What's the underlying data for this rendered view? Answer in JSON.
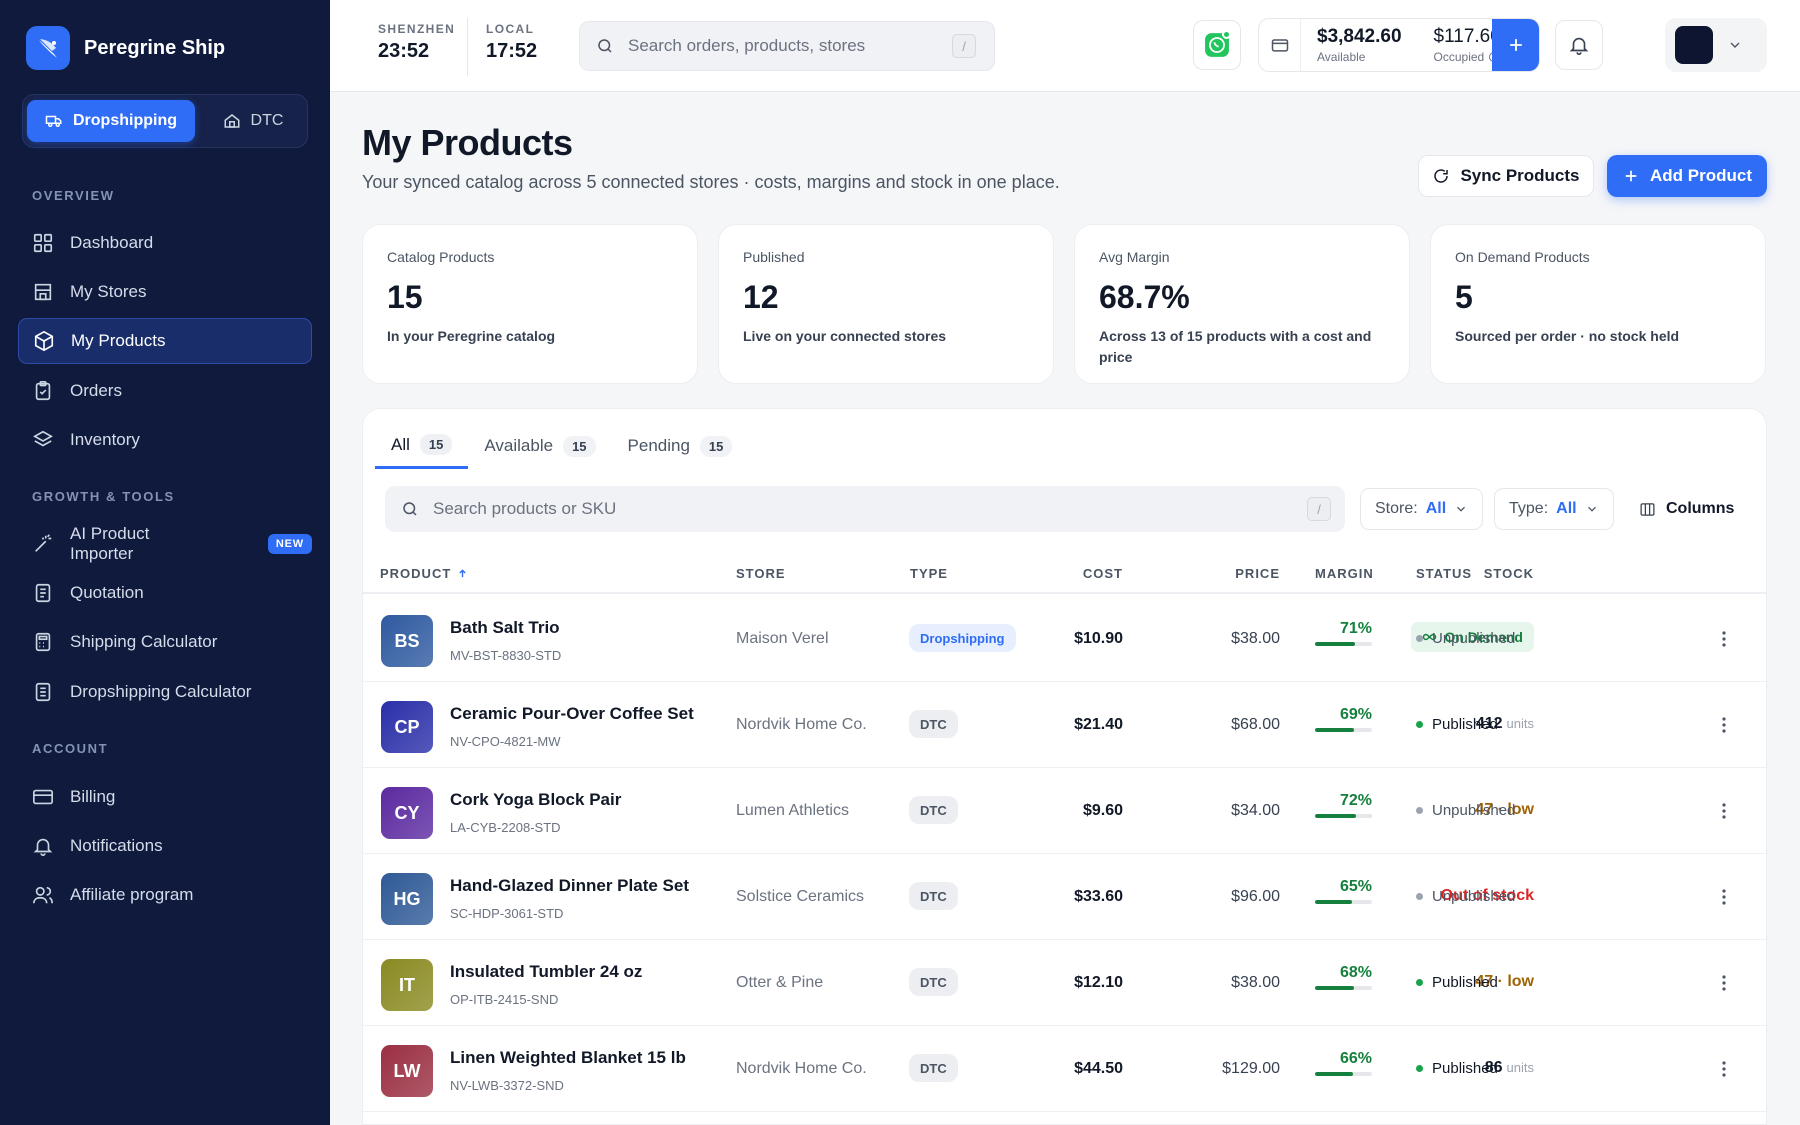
{
  "brand": {
    "name": "Peregrine Ship"
  },
  "mode_switch": {
    "active": "Dropshipping",
    "inactive": "DTC"
  },
  "sidebar": {
    "sections": {
      "overview": "OVERVIEW",
      "growth": "GROWTH & TOOLS",
      "account": "ACCOUNT"
    },
    "items": [
      {
        "label": "Dashboard",
        "icon": "grid-icon"
      },
      {
        "label": "My Stores",
        "icon": "store-icon"
      },
      {
        "label": "My Products",
        "icon": "box-icon",
        "active": true
      },
      {
        "label": "Orders",
        "icon": "clipboard-icon"
      },
      {
        "label": "Inventory",
        "icon": "layers-icon"
      },
      {
        "label": "AI Product Importer",
        "icon": "magic-wand-icon",
        "badge": "NEW"
      },
      {
        "label": "Quotation",
        "icon": "document-icon"
      },
      {
        "label": "Shipping Calculator",
        "icon": "calculator-icon"
      },
      {
        "label": "Dropshipping Calculator",
        "icon": "document-icon"
      },
      {
        "label": "Billing",
        "icon": "credit-card-icon"
      },
      {
        "label": "Notifications",
        "icon": "bell-icon"
      },
      {
        "label": "Affiliate program",
        "icon": "users-icon"
      }
    ]
  },
  "topbar": {
    "clocks": [
      {
        "label": "SHENZHEN",
        "time": "23:52"
      },
      {
        "label": "LOCAL",
        "time": "17:52"
      }
    ],
    "search_placeholder": "Search orders, products, stores",
    "search_shortcut": "/",
    "wallet": {
      "available_amount": "$3,842.60",
      "available_label": "Available",
      "occupied_amount": "$117.60",
      "occupied_label": "Occupied"
    }
  },
  "page": {
    "title": "My Products",
    "subtitle": "Your synced catalog across 5 connected stores · costs, margins and stock in one place.",
    "sync_label": "Sync Products",
    "add_label": "Add Product"
  },
  "stats": [
    {
      "label": "Catalog Products",
      "value": "15",
      "desc": "In your Peregrine catalog"
    },
    {
      "label": "Published",
      "value": "12",
      "desc": "Live on your connected stores"
    },
    {
      "label": "Avg Margin",
      "value": "68.7%",
      "desc": "Across 13 of 15 products with a cost and price"
    },
    {
      "label": "On Demand Products",
      "value": "5",
      "desc": "Sourced per order · no stock held"
    }
  ],
  "tabs": [
    {
      "label": "All",
      "count": "15"
    },
    {
      "label": "Available",
      "count": "15"
    },
    {
      "label": "Pending",
      "count": "15"
    }
  ],
  "filters": {
    "search_placeholder": "Search products or SKU",
    "search_shortcut": "/",
    "store_label": "Store:",
    "store_value": "All",
    "type_label": "Type:",
    "type_value": "All",
    "columns_label": "Columns"
  },
  "table": {
    "headers": {
      "product": "PRODUCT",
      "store": "STORE",
      "type": "TYPE",
      "cost": "COST",
      "price": "PRICE",
      "margin": "MARGIN",
      "stock": "STOCK",
      "status": "STATUS"
    },
    "rows": [
      {
        "initials": "BS",
        "color": "#2f5aa0",
        "name": "Bath Salt Trio",
        "sku": "MV-BST-8830-STD",
        "store": "Maison Verel",
        "type": "Dropshipping",
        "cost": "$10.90",
        "price": "$38.00",
        "margin": "71%",
        "margin_value": 71,
        "stock_kind": "ondemand",
        "stock": "On Demand",
        "stock_unit": "",
        "status": "Unpublished"
      },
      {
        "initials": "CP",
        "color": "#2a2fa8",
        "name": "Ceramic Pour-Over Coffee Set",
        "sku": "NV-CPO-4821-MW",
        "store": "Nordvik Home Co.",
        "type": "DTC",
        "cost": "$21.40",
        "price": "$68.00",
        "margin": "69%",
        "margin_value": 69,
        "stock_kind": "units",
        "stock": "412",
        "stock_unit": "units",
        "status": "Published"
      },
      {
        "initials": "CY",
        "color": "#5b2aa0",
        "name": "Cork Yoga Block Pair",
        "sku": "LA-CYB-2208-STD",
        "store": "Lumen Athletics",
        "type": "DTC",
        "cost": "$9.60",
        "price": "$34.00",
        "margin": "72%",
        "margin_value": 72,
        "stock_kind": "low",
        "stock": "47 · low",
        "stock_unit": "",
        "status": "Unpublished"
      },
      {
        "initials": "HG",
        "color": "#2f5a96",
        "name": "Hand-Glazed Dinner Plate Set",
        "sku": "SC-HDP-3061-STD",
        "store": "Solstice Ceramics",
        "type": "DTC",
        "cost": "$33.60",
        "price": "$96.00",
        "margin": "65%",
        "margin_value": 65,
        "stock_kind": "out",
        "stock": "Out of stock",
        "stock_unit": "",
        "status": "Unpublished"
      },
      {
        "initials": "IT",
        "color": "#8a8a22",
        "name": "Insulated Tumbler 24 oz",
        "sku": "OP-ITB-2415-SND",
        "store": "Otter & Pine",
        "type": "DTC",
        "cost": "$12.10",
        "price": "$38.00",
        "margin": "68%",
        "margin_value": 68,
        "stock_kind": "low",
        "stock": "47 · low",
        "stock_unit": "",
        "status": "Published"
      },
      {
        "initials": "LW",
        "color": "#9a2f42",
        "name": "Linen Weighted Blanket 15 lb",
        "sku": "NV-LWB-3372-SND",
        "store": "Nordvik Home Co.",
        "type": "DTC",
        "cost": "$44.50",
        "price": "$129.00",
        "margin": "66%",
        "margin_value": 66,
        "stock_kind": "units",
        "stock": "86",
        "stock_unit": "units",
        "status": "Published"
      }
    ]
  }
}
